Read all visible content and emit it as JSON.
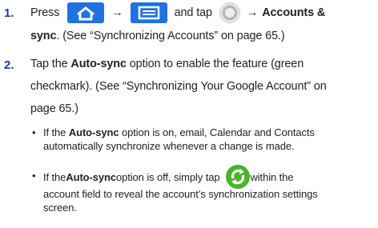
{
  "steps": [
    {
      "number": "1.",
      "line1": {
        "t1": "Press",
        "arrow1": "→",
        "t2": "and tap",
        "arrow2": "→",
        "bold1": "Accounts &"
      },
      "line2": {
        "bold": "sync",
        "rest": ". (See “Synchronizing Accounts” on page 65.)"
      }
    },
    {
      "number": "2.",
      "line1": {
        "t1": "Tap the ",
        "bold": "Auto-sync",
        "t2": " option to enable the feature (green"
      },
      "line2": "checkmark). (See “Synchronizing Your Google Account” on",
      "line3": "page 65.)"
    }
  ],
  "bullets": [
    {
      "dot": "•",
      "line1": {
        "t1": "If the ",
        "bold": "Auto-sync",
        "t2": " option is on, email, Calendar and Contacts"
      },
      "line2": "automatically synchronize whenever a change is made."
    },
    {
      "dot": "•",
      "line1": {
        "t1": "If the ",
        "bold": "Auto-sync",
        "t2": " option is off, simply tap",
        "t3": " within the"
      },
      "line2": "account field to reveal the account’s synchronization settings",
      "line3": "screen."
    }
  ],
  "icons": [
    "home-icon",
    "menu-icon",
    "settings-gear-icon",
    "sync-icon"
  ],
  "colors": {
    "step_number": "#1a3e8a",
    "icon_blue": "#1f72e0",
    "sync_green": "#49b32b"
  }
}
